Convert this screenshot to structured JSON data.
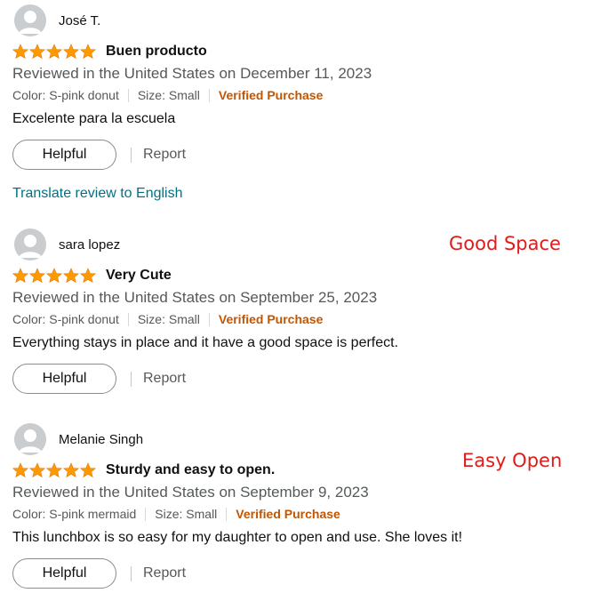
{
  "reviews": [
    {
      "profile_name": "José T.",
      "rating": 5,
      "title": "Buen producto",
      "date": "Reviewed in the United States on December 11, 2023",
      "color": "Color: S-pink donut",
      "size": "Size: Small",
      "verified": "Verified Purchase",
      "body": "Excelente para la escuela",
      "helpful_label": "Helpful",
      "report_label": "Report",
      "translate_label": "Translate review to English"
    },
    {
      "profile_name": "sara lopez",
      "rating": 5,
      "title": "Very Cute",
      "date": "Reviewed in the United States on September 25, 2023",
      "color": "Color: S-pink donut",
      "size": "Size: Small",
      "verified": "Verified Purchase",
      "body": "Everything stays in place and it have a good space is perfect.",
      "helpful_label": "Helpful",
      "report_label": "Report"
    },
    {
      "profile_name": "Melanie Singh",
      "rating": 5,
      "title": "Sturdy and easy to open.",
      "date": "Reviewed in the United States on September 9, 2023",
      "color": "Color: S-pink mermaid",
      "size": "Size: Small",
      "verified": "Verified Purchase",
      "body": "This lunchbox is so easy for my daughter to open and use. She loves it!",
      "helpful_label": "Helpful",
      "report_label": "Report"
    }
  ],
  "annotations": {
    "good_space": "Good Space",
    "easy_open": "Easy Open"
  },
  "colors": {
    "star": "#ff9900",
    "verified": "#c45500",
    "link": "#007185",
    "annotation": "#e01b1b"
  }
}
